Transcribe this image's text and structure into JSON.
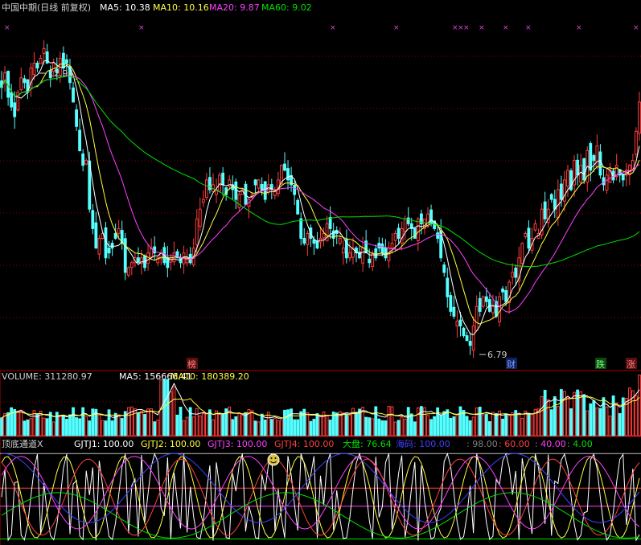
{
  "header": {
    "title": "中国中期(日线 前复权)",
    "ma5": "MA5: 10.38",
    "ma10": "MA10: 10.16",
    "ma20": "MA20: 9.87",
    "ma60": "MA60: 9.02"
  },
  "price_panel": {
    "high_marker": "12.94",
    "low_marker": "6.79",
    "tags": [
      "榜",
      "财",
      "跌",
      "涨"
    ]
  },
  "volume_panel": {
    "volume": "VOLUME: 311280.97",
    "ma5": "MA5: 156666.41",
    "ma10": "MA10: 180389.20"
  },
  "indicator_panel": {
    "name": "顶底通道X",
    "gjtj1": "GJTJ1: 100.00",
    "gjtj2": "GJTJ2: 100.00",
    "gjtj3": "GJTJ3: 100.00",
    "gjtj4": "GJTJ4: 100.00",
    "dapan": "大盘: 76.64",
    "haima": "海码: 100.00",
    "v98": ": 98.00",
    "v60": ": 60.00",
    "v40": ": 40.00",
    "v4": ": 4.00"
  },
  "colors": {
    "up": "#ff3c3c",
    "down": "#54ffff",
    "ma5": "#ffffff",
    "ma10": "#ffff40",
    "ma20": "#ff40ff",
    "ma60": "#00e000",
    "grid": "#8b0000"
  },
  "chart_data": [
    {
      "type": "candlestick",
      "title": "中国中期(日线 前复权)",
      "ylim": [
        6.3,
        13.6
      ],
      "x": [
        1,
        2,
        3,
        4,
        5,
        6,
        7,
        8,
        9,
        10,
        11,
        12,
        13,
        14,
        15,
        16,
        17,
        18,
        19,
        20,
        21,
        22,
        23,
        24,
        25,
        26,
        27,
        28,
        29,
        30,
        31,
        32,
        33,
        34,
        35,
        36,
        37,
        38,
        39,
        40,
        41,
        42,
        43,
        44,
        45,
        46,
        47,
        48,
        49,
        50,
        51,
        52,
        53,
        54,
        55,
        56,
        57,
        58,
        59,
        60,
        61,
        62,
        63,
        64,
        65,
        66,
        67,
        68,
        69,
        70,
        71,
        72,
        73,
        74,
        75,
        76,
        77,
        78,
        79,
        80,
        81,
        82,
        83,
        84,
        85,
        86,
        87,
        88,
        89,
        90,
        91,
        92,
        93,
        94,
        95,
        96,
        97,
        98,
        99,
        100,
        101,
        102,
        103,
        104,
        105,
        106,
        107,
        108,
        109,
        110,
        111,
        112,
        113,
        114,
        115,
        116,
        117,
        118,
        119,
        120,
        121,
        122,
        123,
        124,
        125,
        126,
        127,
        128,
        129,
        130,
        131,
        132,
        133,
        134,
        135,
        136,
        137,
        138,
        139,
        140,
        141,
        142,
        143,
        144,
        145,
        146,
        147,
        148,
        149,
        150,
        151,
        152,
        153,
        154,
        155,
        156,
        157,
        158,
        159,
        160,
        161,
        162,
        163,
        164,
        165,
        166,
        167,
        168,
        169,
        170,
        171,
        172,
        173,
        174,
        175,
        176,
        177,
        178,
        179,
        180,
        181,
        182,
        183,
        184,
        185,
        186,
        187,
        188,
        189,
        190,
        191,
        192,
        193,
        194,
        195,
        196,
        197,
        198
      ],
      "close": [
        12.1,
        12.4,
        11.9,
        11.7,
        11.5,
        12.0,
        12.3,
        12.2,
        12.0,
        12.5,
        12.6,
        12.5,
        12.7,
        12.9,
        12.6,
        12.3,
        12.6,
        12.4,
        12.7,
        12.5,
        12.6,
        12.2,
        11.8,
        11.3,
        10.8,
        10.5,
        10.6,
        9.6,
        9.2,
        8.8,
        9.0,
        9.1,
        8.6,
        8.7,
        8.8,
        9.0,
        9.2,
        8.9,
        8.3,
        8.4,
        8.5,
        8.6,
        8.5,
        8.6,
        8.4,
        8.7,
        8.8,
        8.7,
        8.6,
        8.7,
        8.5,
        8.4,
        8.6,
        8.7,
        8.6,
        8.5,
        8.7,
        8.6,
        8.5,
        8.8,
        9.4,
        9.6,
        9.8,
        10.2,
        10.0,
        10.1,
        10.0,
        10.3,
        10.1,
        9.9,
        10.2,
        10.0,
        9.8,
        9.9,
        10.0,
        9.7,
        9.8,
        9.9,
        10.1,
        10.2,
        10.0,
        9.8,
        10.1,
        10.0,
        10.0,
        10.2,
        10.5,
        10.4,
        10.2,
        10.1,
        9.9,
        9.5,
        9.0,
        8.9,
        9.1,
        9.0,
        8.9,
        8.8,
        9.0,
        9.1,
        9.3,
        9.2,
        9.0,
        9.1,
        9.0,
        8.8,
        8.6,
        8.7,
        8.8,
        8.7,
        8.6,
        8.8,
        8.7,
        8.5,
        8.7,
        8.6,
        8.8,
        8.7,
        8.6,
        8.8,
        8.9,
        9.1,
        9.0,
        9.2,
        9.4,
        9.3,
        9.2,
        9.0,
        9.4,
        9.3,
        9.4,
        9.5,
        9.3,
        9.2,
        9.0,
        8.6,
        8.3,
        7.8,
        7.5,
        7.4,
        7.3,
        7.2,
        7.0,
        6.9,
        6.8,
        7.2,
        7.6,
        7.5,
        7.8,
        7.7,
        7.5,
        7.6,
        7.4,
        7.8,
        7.9,
        7.7,
        8.1,
        8.3,
        8.2,
        8.6,
        8.9,
        9.1,
        8.8,
        9.0,
        9.3,
        9.1,
        9.6,
        9.4,
        9.6,
        9.8,
        9.6,
        10.0,
        9.8,
        10.2,
        10.4,
        10.0,
        10.6,
        10.3,
        10.5,
        10.2,
        10.8,
        10.4,
        10.6,
        10.9,
        10.3,
        10.1,
        10.3,
        10.4,
        10.2,
        10.5,
        10.3,
        10.2,
        10.4,
        10.5,
        10.6,
        11.2,
        11.8
      ]
    },
    {
      "type": "bar",
      "title": "VOLUME",
      "ylim": [
        0,
        330000
      ]
    },
    {
      "type": "line",
      "title": "顶底通道X",
      "ylim": [
        0,
        100
      ],
      "reference_lines": [
        98,
        60,
        40,
        4
      ]
    }
  ]
}
